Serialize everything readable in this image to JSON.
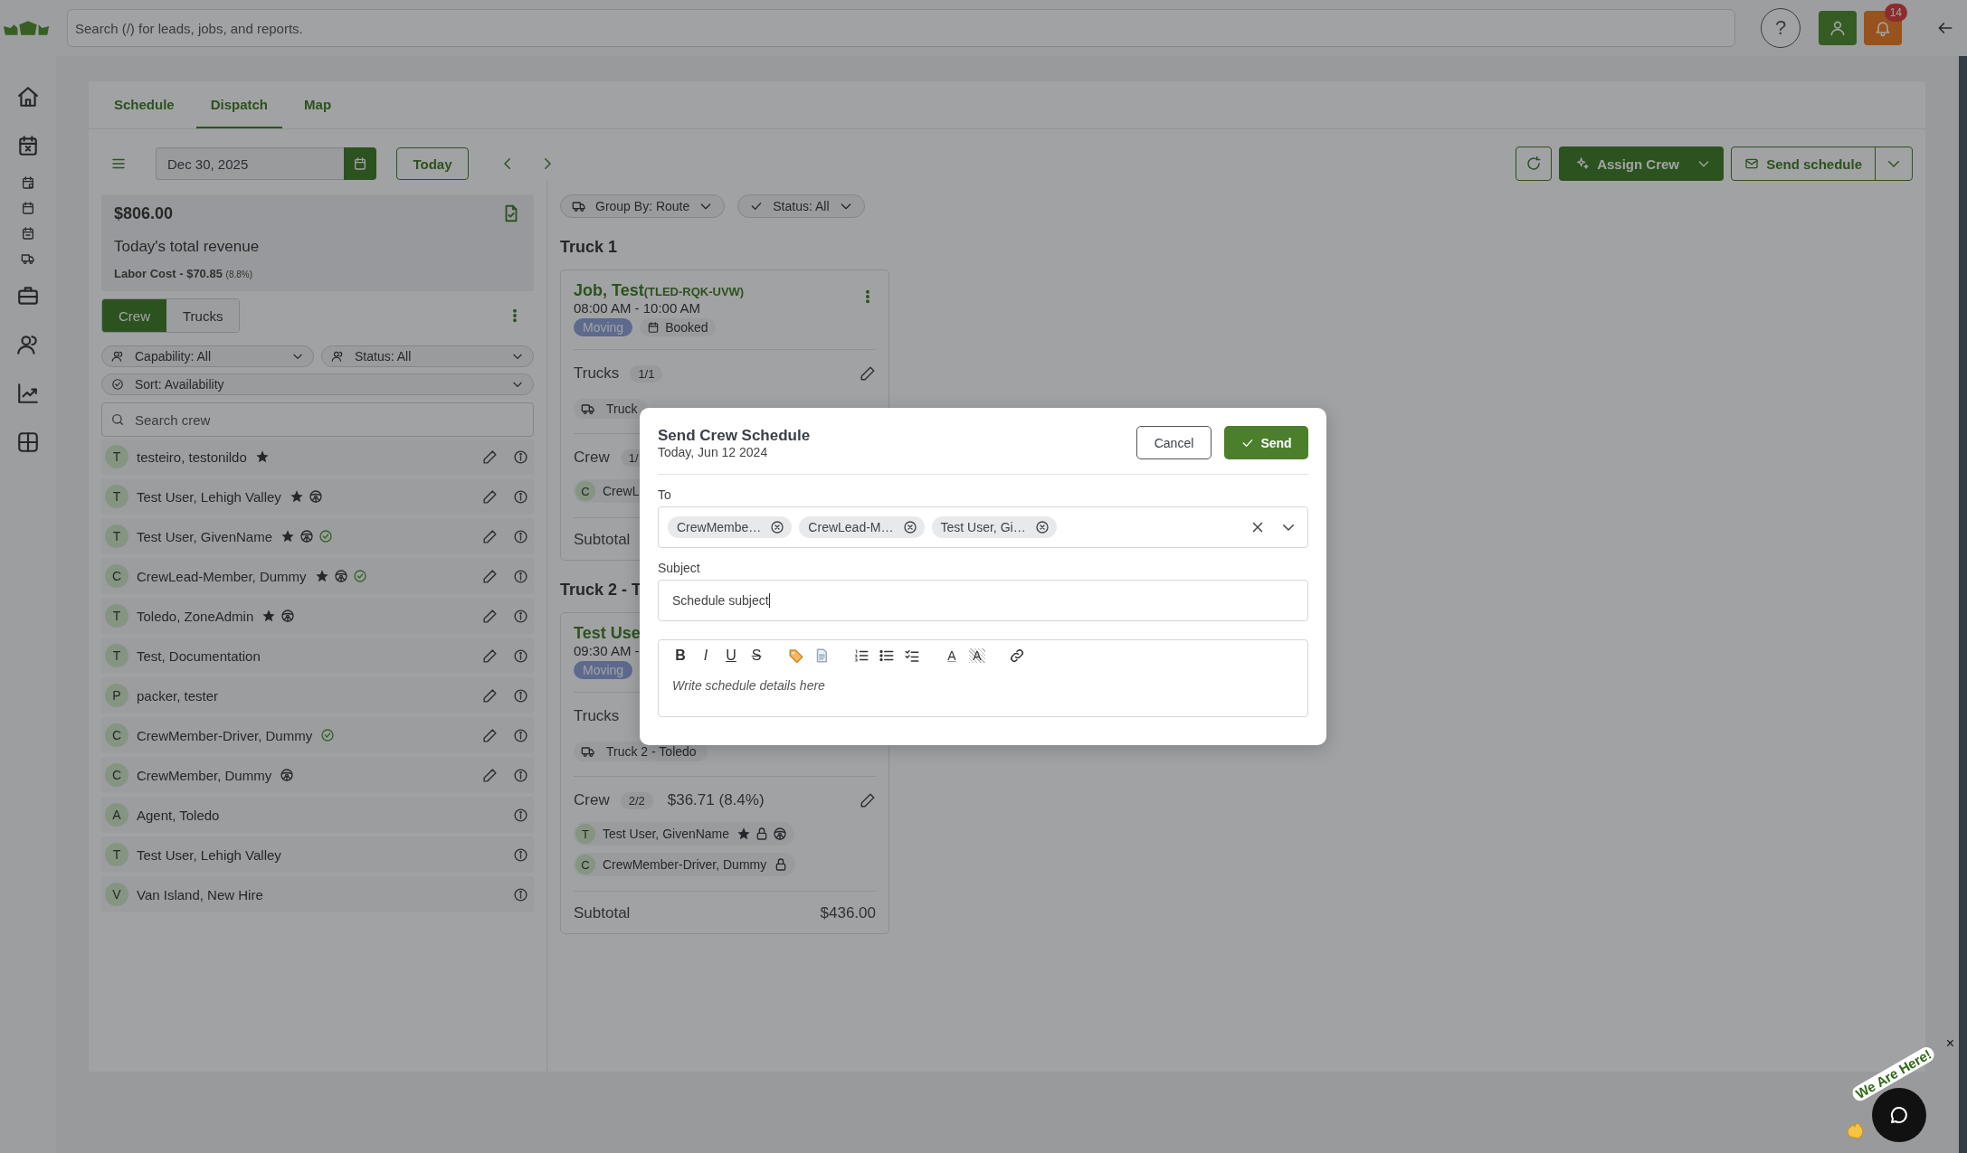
{
  "header": {
    "search_placeholder": "Search (/) for leads, jobs, and reports.",
    "help": "?",
    "notification_count": "14"
  },
  "tabs": [
    {
      "label": "Schedule",
      "selected": false
    },
    {
      "label": "Dispatch",
      "selected": true
    },
    {
      "label": "Map",
      "selected": false
    }
  ],
  "toolbar": {
    "date": "Dec 30, 2025",
    "today": "Today",
    "assign": "Assign Crew",
    "send": "Send schedule"
  },
  "revenue": {
    "amount": "$806.00",
    "label": "Today's total revenue",
    "labor": "Labor Cost - $70.85",
    "labor_pct": "(8.8%)"
  },
  "panel_tabs": [
    {
      "label": "Crew",
      "selected": true
    },
    {
      "label": "Trucks",
      "selected": false
    }
  ],
  "filters": {
    "capability": "Capability: All",
    "status": "Status: All",
    "sort": "Sort: Availability",
    "search_placeholder": "Search crew"
  },
  "crew": [
    {
      "initial": "T",
      "name": "testeiro, testonildo",
      "star": true,
      "editable": true
    },
    {
      "initial": "T",
      "name": "Test User, Lehigh Valley",
      "star": true,
      "driver": true,
      "editable": true
    },
    {
      "initial": "T",
      "name": "Test User, GivenName",
      "star": true,
      "driver": true,
      "verified": true,
      "editable": true
    },
    {
      "initial": "C",
      "name": "CrewLead-Member, Dummy",
      "star": true,
      "driver": true,
      "verified": true,
      "editable": true
    },
    {
      "initial": "T",
      "name": "Toledo, ZoneAdmin",
      "star": true,
      "driver": true,
      "editable": true
    },
    {
      "initial": "T",
      "name": "Test, Documentation",
      "editable": true
    },
    {
      "initial": "P",
      "name": "packer, tester",
      "editable": true
    },
    {
      "initial": "C",
      "name": "CrewMember-Driver, Dummy",
      "verified": true,
      "editable": true
    },
    {
      "initial": "C",
      "name": "CrewMember, Dummy",
      "driver": true,
      "editable": true
    },
    {
      "initial": "A",
      "name": "Agent, Toledo",
      "editable": false
    },
    {
      "initial": "T",
      "name": "Test User, Lehigh Valley",
      "editable": false
    },
    {
      "initial": "V",
      "name": "Van Island, New Hire",
      "editable": false
    }
  ],
  "board": {
    "group_by": "Group By: Route",
    "status": "Status: All",
    "groups": [
      {
        "title": "Truck 1",
        "job": {
          "title": "Job, Test",
          "code": "(TLED-RQK-UVW)",
          "time": "08:00 AM - 10:00 AM",
          "menu": true,
          "tags": [
            {
              "kind": "service",
              "label": "Moving"
            },
            {
              "kind": "status",
              "label": "Booked"
            }
          ],
          "trucks": {
            "label": "Trucks",
            "count": "1/1",
            "editable": true,
            "items": [
              "Truck"
            ]
          },
          "crew": {
            "label": "Crew",
            "count": "1/",
            "editable": false,
            "members": [
              {
                "initial": "C",
                "name": "CrewL"
              }
            ]
          },
          "subtotal": {
            "label": "Subtotal"
          }
        }
      },
      {
        "title": "Truck 2 - T",
        "job": {
          "title": "Test Use",
          "time": "09:30 AM -",
          "menu": false,
          "tags": [
            {
              "kind": "service",
              "label": "Moving"
            }
          ],
          "trucks": {
            "label": "Trucks",
            "editable": false,
            "items": [
              "Truck 2 - Toledo"
            ]
          },
          "crew": {
            "label": "Crew",
            "count": "2/2",
            "cost": "$36.71 (8.4%)",
            "editable": true,
            "members": [
              {
                "initial": "T",
                "name": "Test User, GivenName",
                "star": true,
                "locked": true,
                "driver": true
              },
              {
                "initial": "C",
                "name": "CrewMember-Driver, Dummy",
                "locked": true
              }
            ]
          },
          "subtotal": {
            "label": "Subtotal",
            "amount": "$436.00"
          }
        }
      }
    ]
  },
  "modal": {
    "title": "Send Crew Schedule",
    "subtitle": "Today, Jun 12 2024",
    "cancel": "Cancel",
    "send": "Send",
    "to_label": "To",
    "recipients": [
      "CrewMembe…",
      "CrewLead-M…",
      "Test User, Gi…"
    ],
    "subject_label": "Subject",
    "subject": "Schedule subject",
    "body_placeholder": "Write schedule details here",
    "tools": [
      {
        "kind": "bold",
        "glyph": "B"
      },
      {
        "kind": "italic",
        "glyph": "I"
      },
      {
        "kind": "underline",
        "glyph": "U"
      },
      {
        "kind": "strike",
        "glyph": "S"
      },
      {
        "kind": "tag"
      },
      {
        "kind": "doc"
      },
      {
        "kind": "ol"
      },
      {
        "kind": "ul"
      },
      {
        "kind": "checklist"
      },
      {
        "kind": "color",
        "glyph": "A"
      },
      {
        "kind": "highlight",
        "glyph": "A"
      },
      {
        "kind": "link"
      }
    ]
  },
  "chat": {
    "label": "We Are Here!",
    "close": "×"
  }
}
